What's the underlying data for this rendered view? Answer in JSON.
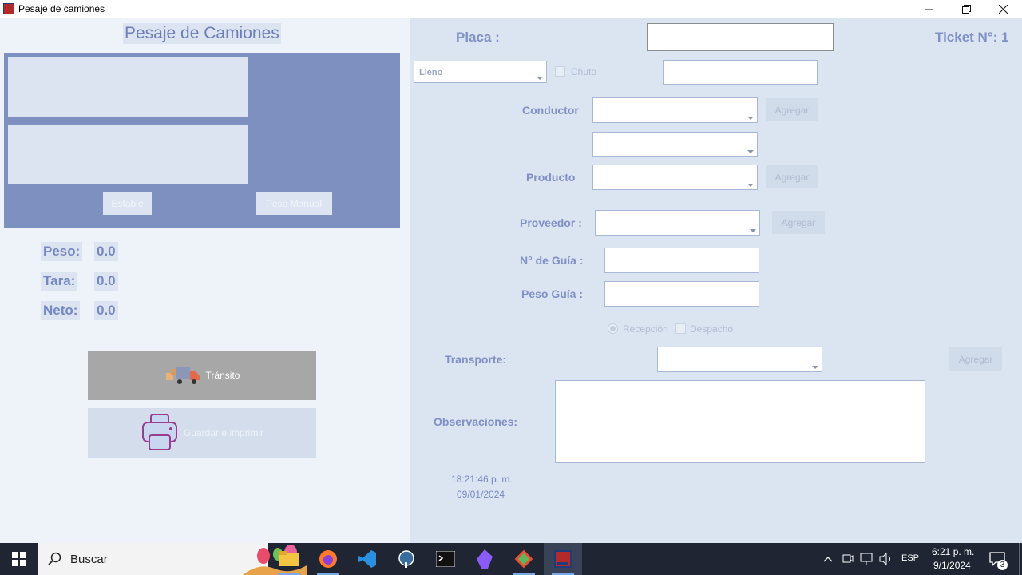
{
  "window": {
    "title": "Pesaje de camiones"
  },
  "left": {
    "heading": "Pesaje de Camiones",
    "estable_button": "Estable",
    "peso_manual_button": "Peso Manual",
    "peso_label": "Peso:",
    "peso_value": "0.0",
    "tara_label": "Tara:",
    "tara_value": "0.0",
    "neto_label": "Neto:",
    "neto_value": "0.0",
    "transito_button": "Tránsito",
    "guardar_button": "Guardar e imprimir"
  },
  "right": {
    "placa_label": "Placa :",
    "ticket_label": "Ticket N°: 1",
    "estado_combo": "Lleno",
    "chuto_label": "Chuto",
    "conductor_label": "Conductor",
    "producto_label": "Producto",
    "proveedor_label": "Proveedor :",
    "guia_label": "N° de Guía :",
    "peso_guia_label": "Peso Guía :",
    "recepcion_label": "Recepción",
    "despacho_label": "Despacho",
    "transporte_label": "Transporte:",
    "observaciones_label": "Observaciones:",
    "agregar_label": "Agregar",
    "time": "18:21:46 p. m.",
    "date": "09/01/2024"
  },
  "taskbar": {
    "search_placeholder": "Buscar",
    "language": "ESP",
    "clock_time": "6:21 p. m.",
    "clock_date": "9/1/2024",
    "notification_count": "3"
  }
}
